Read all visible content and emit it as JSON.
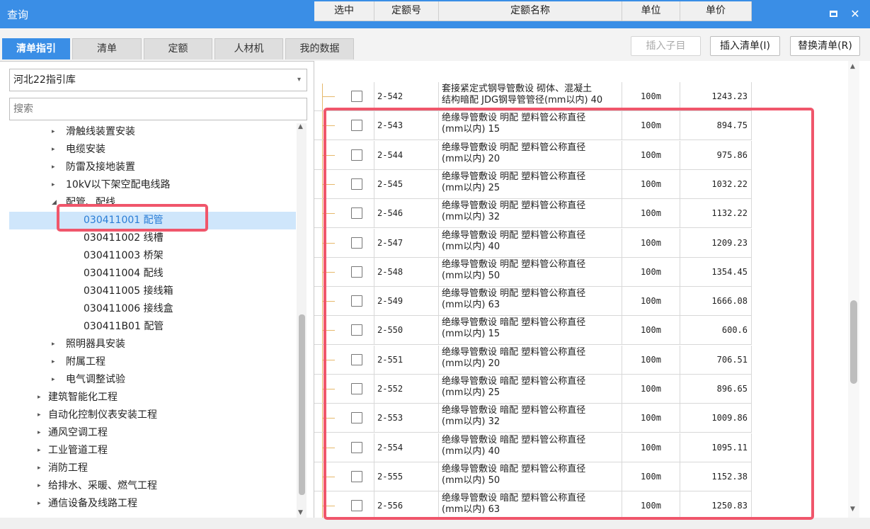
{
  "window": {
    "title": "查询",
    "restore_icon": "restore-icon",
    "close_icon": "close-icon",
    "close_glyph": "✕"
  },
  "tabs": [
    {
      "label": "清单指引",
      "active": true
    },
    {
      "label": "清单",
      "active": false
    },
    {
      "label": "定额",
      "active": false
    },
    {
      "label": "人材机",
      "active": false
    },
    {
      "label": "我的数据",
      "active": false
    }
  ],
  "toolbar": {
    "insert_child": "插入子目",
    "insert_list": "插入清单(I)",
    "replace_list": "替换清单(R)"
  },
  "library_select": {
    "value": "河北22指引库",
    "arrow": "▾"
  },
  "search": {
    "placeholder": "搜索"
  },
  "tree": [
    {
      "label": "滑触线装置安装",
      "marker": "▸",
      "level": 2
    },
    {
      "label": "电缆安装",
      "marker": "▸",
      "level": 2
    },
    {
      "label": "防雷及接地装置",
      "marker": "▸",
      "level": 2
    },
    {
      "label": "10kV以下架空配电线路",
      "marker": "▸",
      "level": 2
    },
    {
      "label": "配管、配线",
      "marker": "◢",
      "level": 2
    },
    {
      "label": "030411001  配管",
      "marker": "",
      "level": 3,
      "selected": true
    },
    {
      "label": "030411002  线槽",
      "marker": "",
      "level": 3
    },
    {
      "label": "030411003  桥架",
      "marker": "",
      "level": 3
    },
    {
      "label": "030411004  配线",
      "marker": "",
      "level": 3
    },
    {
      "label": "030411005  接线箱",
      "marker": "",
      "level": 3
    },
    {
      "label": "030411006  接线盒",
      "marker": "",
      "level": 3
    },
    {
      "label": "030411B01  配管",
      "marker": "",
      "level": 3
    },
    {
      "label": "照明器具安装",
      "marker": "▸",
      "level": 2
    },
    {
      "label": "附属工程",
      "marker": "▸",
      "level": 2
    },
    {
      "label": "电气调整试验",
      "marker": "▸",
      "level": 2
    },
    {
      "label": "建筑智能化工程",
      "marker": "▸",
      "level": 1
    },
    {
      "label": "自动化控制仪表安装工程",
      "marker": "▸",
      "level": 1
    },
    {
      "label": "通风空调工程",
      "marker": "▸",
      "level": 1
    },
    {
      "label": "工业管道工程",
      "marker": "▸",
      "level": 1
    },
    {
      "label": "消防工程",
      "marker": "▸",
      "level": 1
    },
    {
      "label": "给排水、采暖、燃气工程",
      "marker": "▸",
      "level": 1
    },
    {
      "label": "通信设备及线路工程",
      "marker": "▸",
      "level": 1
    }
  ],
  "table": {
    "columns": [
      "选中",
      "定额号",
      "定额名称",
      "单位",
      "单价"
    ],
    "rows": [
      {
        "code": "2-542",
        "name": "套接紧定式钢导管敷设 砌体、混凝土\n结构暗配 JDG钢导管管径(mm以内) 40",
        "unit": "100m",
        "price": "1243.23"
      },
      {
        "code": "2-543",
        "name": "绝缘导管敷设 明配 塑料管公称直径\n(mm以内) 15",
        "unit": "100m",
        "price": "894.75"
      },
      {
        "code": "2-544",
        "name": "绝缘导管敷设 明配 塑料管公称直径\n(mm以内) 20",
        "unit": "100m",
        "price": "975.86"
      },
      {
        "code": "2-545",
        "name": "绝缘导管敷设 明配 塑料管公称直径\n(mm以内) 25",
        "unit": "100m",
        "price": "1032.22"
      },
      {
        "code": "2-546",
        "name": "绝缘导管敷设 明配 塑料管公称直径\n(mm以内) 32",
        "unit": "100m",
        "price": "1132.22"
      },
      {
        "code": "2-547",
        "name": "绝缘导管敷设 明配 塑料管公称直径\n(mm以内) 40",
        "unit": "100m",
        "price": "1209.23"
      },
      {
        "code": "2-548",
        "name": "绝缘导管敷设 明配 塑料管公称直径\n(mm以内) 50",
        "unit": "100m",
        "price": "1354.45"
      },
      {
        "code": "2-549",
        "name": "绝缘导管敷设 明配 塑料管公称直径\n(mm以内) 63",
        "unit": "100m",
        "price": "1666.08"
      },
      {
        "code": "2-550",
        "name": "绝缘导管敷设 暗配 塑料管公称直径\n(mm以内) 15",
        "unit": "100m",
        "price": "600.6"
      },
      {
        "code": "2-551",
        "name": "绝缘导管敷设 暗配 塑料管公称直径\n(mm以内) 20",
        "unit": "100m",
        "price": "706.51"
      },
      {
        "code": "2-552",
        "name": "绝缘导管敷设 暗配 塑料管公称直径\n(mm以内) 25",
        "unit": "100m",
        "price": "896.65"
      },
      {
        "code": "2-553",
        "name": "绝缘导管敷设 暗配 塑料管公称直径\n(mm以内) 32",
        "unit": "100m",
        "price": "1009.86"
      },
      {
        "code": "2-554",
        "name": "绝缘导管敷设 暗配 塑料管公称直径\n(mm以内) 40",
        "unit": "100m",
        "price": "1095.11"
      },
      {
        "code": "2-555",
        "name": "绝缘导管敷设 暗配 塑料管公称直径\n(mm以内) 50",
        "unit": "100m",
        "price": "1152.38"
      },
      {
        "code": "2-556",
        "name": "绝缘导管敷设 暗配 塑料管公称直径\n(mm以内) 63",
        "unit": "100m",
        "price": "1250.83"
      }
    ]
  },
  "scroll": {
    "up": "▲",
    "down": "▼"
  },
  "colors": {
    "accent": "#3a8ee6",
    "highlight": "#f0566b",
    "selection": "#cfe6fb"
  }
}
